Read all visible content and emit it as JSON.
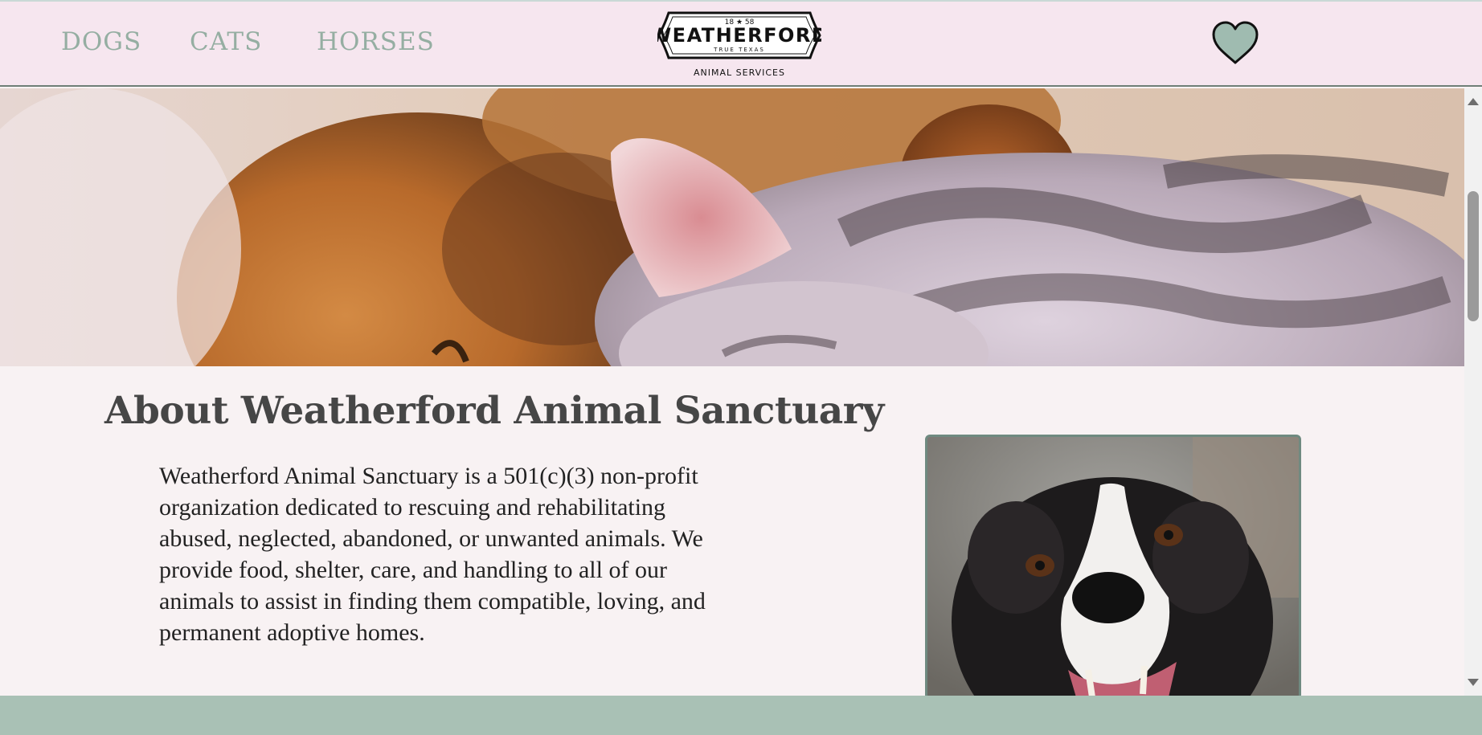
{
  "nav": {
    "items": [
      {
        "label": "DOGS"
      },
      {
        "label": "CATS"
      },
      {
        "label": "HORSES"
      }
    ]
  },
  "logo": {
    "year": "1858",
    "name": "WEATHERFORD",
    "tagline": "TRUE TEXAS",
    "subtitle": "ANIMAL SERVICES"
  },
  "header": {
    "favorites_icon": "heart-icon"
  },
  "hero": {
    "image_subject": "puppy and kitten sleeping"
  },
  "about": {
    "title": "About Weatherford Animal Sanctuary",
    "body": "Weatherford Animal Sanctuary is a 501(c)(3) non-profit organization dedicated to rescuing and rehabilitating abused, neglected, abandoned, or unwanted animals. We provide food, shelter, care, and handling to all of our animals to assist in finding them compatible, loving, and permanent adoptive homes."
  },
  "colors": {
    "header_bg": "#f6e6ef",
    "nav_text": "#95aea2",
    "accent_sage": "#a9c1b5",
    "heart_fill": "#9fbbb0",
    "page_bg": "#f8f2f3"
  }
}
